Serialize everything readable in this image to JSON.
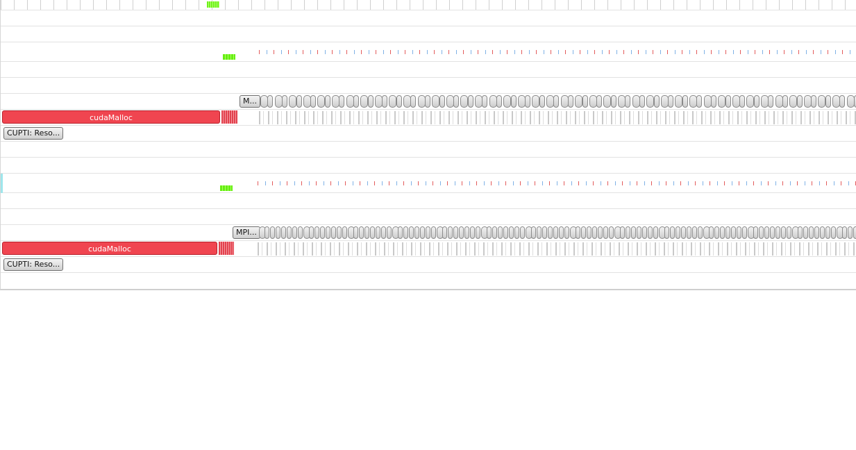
{
  "window": {
    "width": 1233,
    "height": 648
  },
  "colors": {
    "cuda_red": "#f04550",
    "activity_green": "#6ff21a",
    "chip_gray": "#d9d9d9"
  },
  "process_1": {
    "mpi_label": "M...",
    "cuda_label": "cudaMalloc",
    "cupti_label": "CUPTI: Reso..."
  },
  "process_2": {
    "mpi_label": "MPI...",
    "cuda_label": "cudaMalloc",
    "cupti_label": "CUPTI: Reso..."
  }
}
